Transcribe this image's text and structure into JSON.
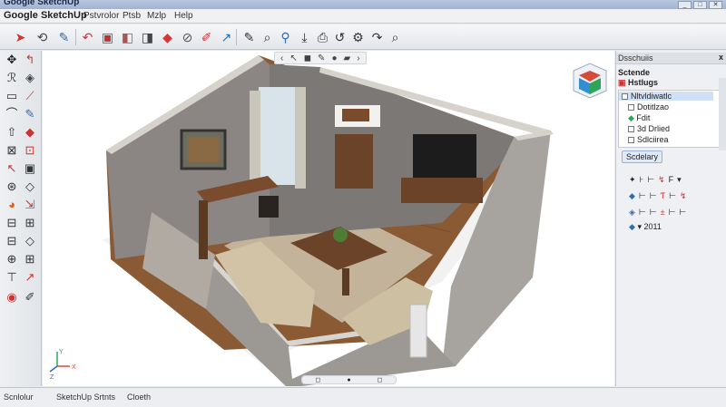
{
  "window": {
    "title": "Google SketchUp",
    "buttons": [
      "_",
      "□",
      "✕"
    ]
  },
  "menu": {
    "app_name": "Google SketchUp",
    "items": [
      "Pstvrolor",
      "Ptsb",
      "Mzlp",
      "Help"
    ]
  },
  "toolbar": {
    "icons": [
      "select-icon",
      "eraser-icon",
      "paint-icon",
      "undo-icon",
      "push-pull-icon",
      "box-icon",
      "box-icon",
      "eraser-icon",
      "tape-icon",
      "pencil-icon",
      "arrow-icon",
      "edit-icon",
      "zoom-icon",
      "pin-icon",
      "print-icon",
      "rotate-icon",
      "gear-icon",
      "redo-icon",
      "zoom-icon"
    ]
  },
  "scene_nav": {
    "prev": "‹",
    "back": "↖",
    "items": [
      "◼",
      "✎",
      "●",
      "▰"
    ],
    "next": "›"
  },
  "bottom_pill": {
    "items": [
      "◻",
      "●",
      "◻"
    ]
  },
  "right_panel": {
    "header": "Dsschuiis",
    "close": "x",
    "section": "Sctende",
    "subsection": "Hstlugs",
    "tree": [
      {
        "label": "Nltvldiwatlc",
        "checked": true
      },
      {
        "label": "Dotitlzao",
        "checked": false
      },
      {
        "label": "Fdit",
        "checked": true
      },
      {
        "label": "3d Drlied",
        "checked": false
      },
      {
        "label": "Sdlciirea",
        "checked": false
      }
    ],
    "tab": "Scdelary",
    "rows": [
      [
        "✦",
        "⊦",
        "⊢",
        "↯",
        "F",
        "▾"
      ],
      [
        "◆",
        "⊢",
        "⊢",
        "Ƭ",
        "⊢",
        "↯"
      ],
      [
        "◈",
        "⊢",
        "⊢",
        "±",
        "⊢",
        "⊢"
      ],
      [
        "◆",
        "▾",
        "2011"
      ]
    ]
  },
  "status": {
    "items": [
      "Scnlolur",
      "SketchUp Srtnts",
      "Cloeth"
    ]
  },
  "axis": {
    "x": "X",
    "y": "Y",
    "z": "Z"
  }
}
